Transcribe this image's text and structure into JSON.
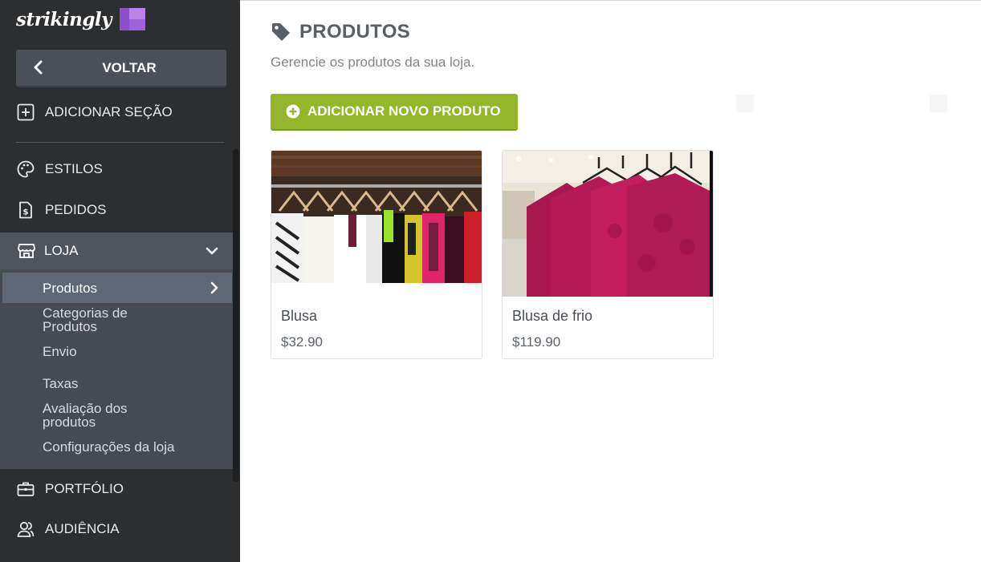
{
  "brand": {
    "name": "strikingly"
  },
  "sidebar": {
    "back_label": "VOLTAR",
    "add_section_label": "ADICIONAR SEÇÃO",
    "items": [
      {
        "label": "ESTILOS",
        "icon": "palette-icon"
      },
      {
        "label": "PEDIDOS",
        "icon": "invoice-icon"
      },
      {
        "label": "LOJA",
        "icon": "store-icon"
      },
      {
        "label": "PORTFÓLIO",
        "icon": "briefcase-icon"
      },
      {
        "label": "AUDIÊNCIA",
        "icon": "users-icon"
      }
    ],
    "loja_subitems": [
      {
        "label": "Produtos",
        "active": true
      },
      {
        "label_line1": "Categorias de",
        "label_line2": "Produtos"
      },
      {
        "label": "Envio"
      },
      {
        "label": "Taxas"
      },
      {
        "label_line1": "Avaliação dos",
        "label_line2": "produtos"
      },
      {
        "label": "Configurações da loja"
      }
    ]
  },
  "main": {
    "title": "PRODUTOS",
    "subtitle": "Gerencie os produtos da sua loja.",
    "add_button_label": "ADICIONAR NOVO PRODUTO",
    "products": [
      {
        "name": "Blusa",
        "price": "$32.90"
      },
      {
        "name": "Blusa de frio",
        "price": "$119.90"
      }
    ]
  },
  "colors": {
    "sidebar_bg": "#2d2e30",
    "sidebar_active": "#5e6776",
    "accent_green": "#93b62a",
    "brand_purple": "#b884e8"
  }
}
